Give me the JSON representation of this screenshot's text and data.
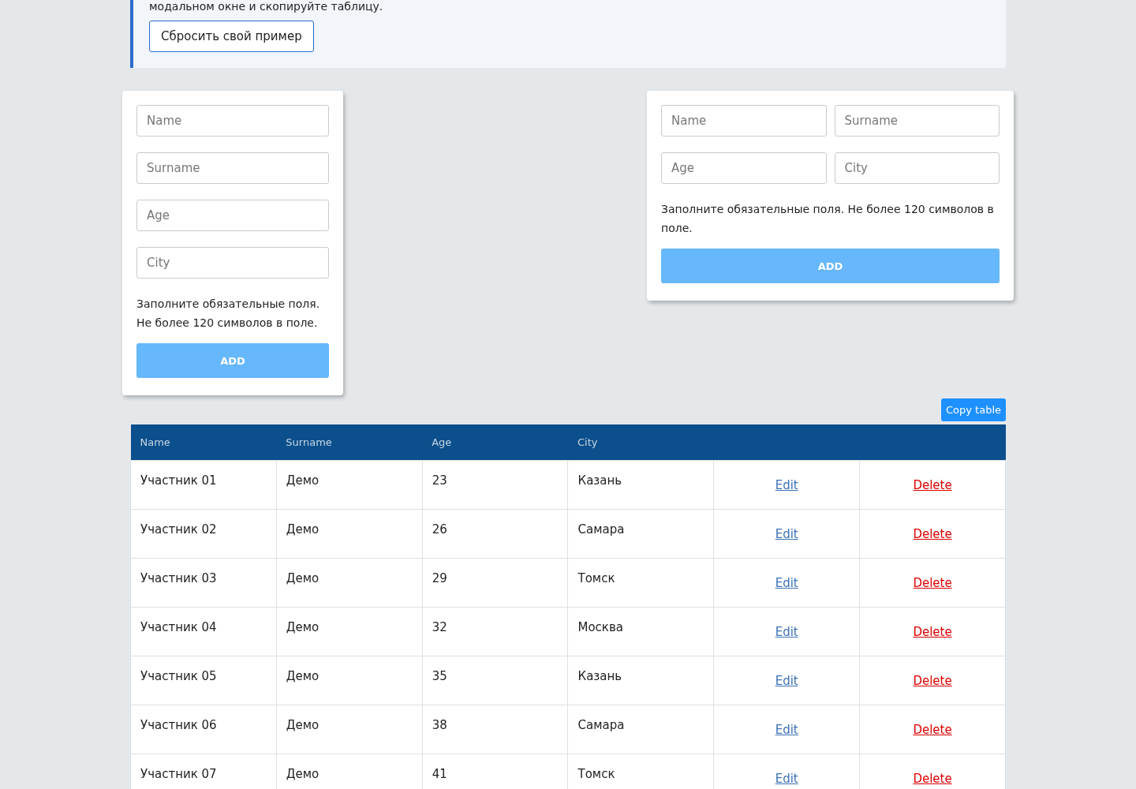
{
  "notice": {
    "text": "модальном окне и скопируйте таблицу.",
    "reset_button": "Сбросить свой пример"
  },
  "forms": [
    {
      "kind": "stacked",
      "fields": [
        {
          "placeholder": "Name"
        },
        {
          "placeholder": "Surname"
        },
        {
          "placeholder": "Age"
        },
        {
          "placeholder": "City"
        }
      ],
      "hint": "Заполните обязательные поля. Не более 120 символов в поле.",
      "button": "ADD"
    },
    {
      "kind": "grid",
      "fields": [
        {
          "placeholder": "Name"
        },
        {
          "placeholder": "Surname"
        },
        {
          "placeholder": "Age"
        },
        {
          "placeholder": "City"
        }
      ],
      "hint": "Заполните обязательные поля. Не более 120 символов в поле.",
      "button": "ADD"
    }
  ],
  "copy_button": "Copy table",
  "table": {
    "columns": [
      "Name",
      "Surname",
      "Age",
      "City"
    ],
    "rows": [
      {
        "cells": [
          "Участник 01",
          "Демо",
          "23",
          "Казань"
        ],
        "edit": "Edit",
        "delete": "Delete"
      },
      {
        "cells": [
          "Участник 02",
          "Демо",
          "26",
          "Самара"
        ],
        "edit": "Edit",
        "delete": "Delete"
      },
      {
        "cells": [
          "Участник 03",
          "Демо",
          "29",
          "Томск"
        ],
        "edit": "Edit",
        "delete": "Delete"
      },
      {
        "cells": [
          "Участник 04",
          "Демо",
          "32",
          "Москва"
        ],
        "edit": "Edit",
        "delete": "Delete"
      },
      {
        "cells": [
          "Участник 05",
          "Демо",
          "35",
          "Казань"
        ],
        "edit": "Edit",
        "delete": "Delete"
      },
      {
        "cells": [
          "Участник 06",
          "Демо",
          "38",
          "Самара"
        ],
        "edit": "Edit",
        "delete": "Delete"
      },
      {
        "cells": [
          "Участник 07",
          "Демо",
          "41",
          "Томск"
        ],
        "edit": "Edit",
        "delete": "Delete"
      }
    ]
  }
}
